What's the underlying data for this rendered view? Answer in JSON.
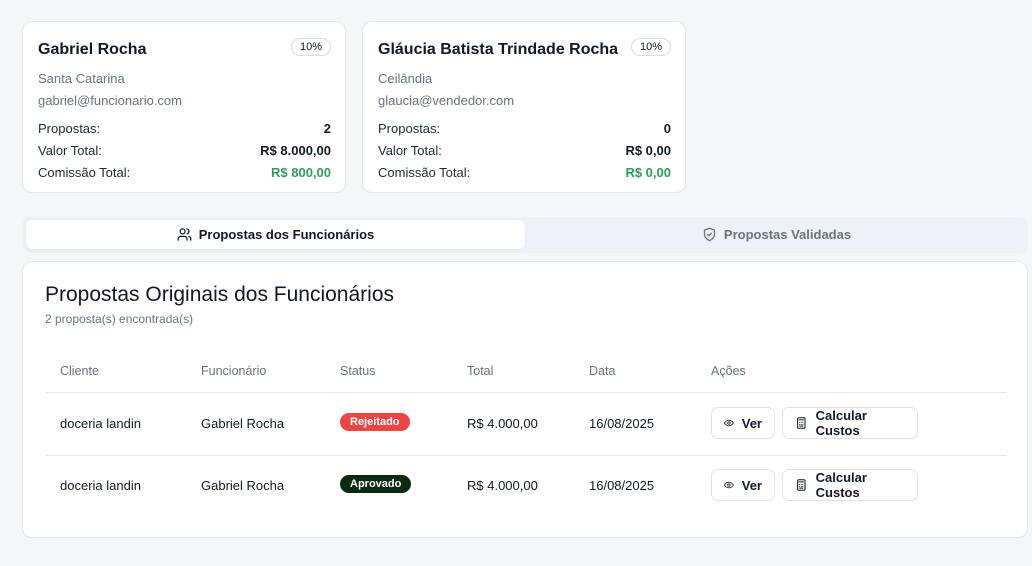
{
  "employees": [
    {
      "name": "Gabriel Rocha",
      "commission_rate": "10%",
      "region": "Santa Catarina",
      "email": "gabriel@funcionario.com",
      "proposals_label": "Propostas:",
      "proposals": "2",
      "total_label": "Valor Total:",
      "total": "R$ 8.000,00",
      "commission_label": "Comissão Total:",
      "commission": "R$ 800,00"
    },
    {
      "name": "Gláucia Batista Trindade Rocha",
      "commission_rate": "10%",
      "region": "Ceilândia",
      "email": "glaucia@vendedor.com",
      "proposals_label": "Propostas:",
      "proposals": "0",
      "total_label": "Valor Total:",
      "total": "R$ 0,00",
      "commission_label": "Comissão Total:",
      "commission": "R$ 0,00"
    }
  ],
  "tabs": [
    {
      "label": "Propostas dos Funcionários",
      "icon": "users-icon",
      "active": true
    },
    {
      "label": "Propostas Validadas",
      "icon": "shield-check-icon",
      "active": false
    }
  ],
  "panel": {
    "title": "Propostas Originais dos Funcionários",
    "subtitle": "2 proposta(s) encontrada(s)"
  },
  "table": {
    "headers": [
      "Cliente",
      "Funcionário",
      "Status",
      "Total",
      "Data",
      "Ações"
    ],
    "rows": [
      {
        "client": "doceria landin",
        "employee": "Gabriel Rocha",
        "status": "Rejeitado",
        "status_color": "#ef4444",
        "total": "R$ 4.000,00",
        "date": "16/08/2025"
      },
      {
        "client": "doceria landin",
        "employee": "Gabriel Rocha",
        "status": "Aprovado",
        "status_color": "#0b2a12",
        "total": "R$ 4.000,00",
        "date": "16/08/2025"
      }
    ],
    "view_label": "Ver",
    "calc_label": "Calcular Custos"
  },
  "colors": {
    "accent_green": "#2f9e5b",
    "rejected": "#ef4444",
    "approved": "#0b2a12"
  }
}
